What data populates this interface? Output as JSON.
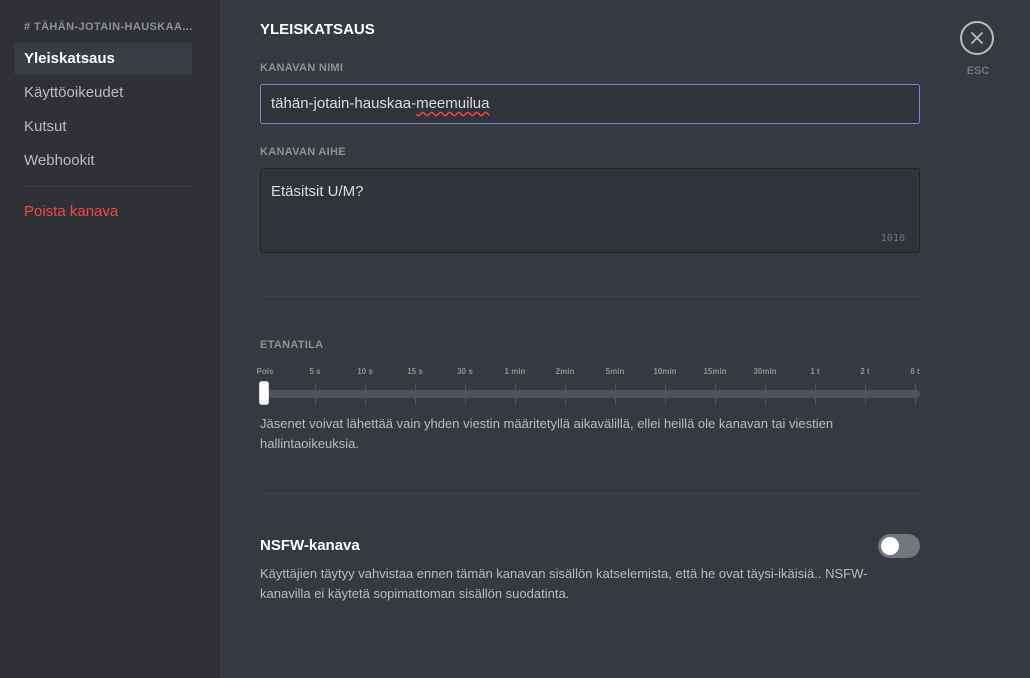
{
  "sidebar": {
    "channel_header": "# TÄHÄN-JOTAIN-HAUSKAA...",
    "items": [
      {
        "label": "Yleiskatsaus",
        "active": true
      },
      {
        "label": "Käyttöoikeudet"
      },
      {
        "label": "Kutsut"
      },
      {
        "label": "Webhookit"
      }
    ],
    "delete_label": "Poista kanava"
  },
  "main": {
    "title": "YLEISKATSAUS",
    "channel_name": {
      "label": "KANAVAN NIMI",
      "value_prefix": "tähän-jotain-hauskaa-",
      "value_misspelled": "meemuilua"
    },
    "channel_topic": {
      "label": "KANAVAN AIHE",
      "value": "Etäsitsit U/M?",
      "char_count": "1010"
    },
    "slowmode": {
      "label": "ETANATILA",
      "ticks": [
        "Pois",
        "5 s",
        "10 s",
        "15 s",
        "30 s",
        "1 min",
        "2min",
        "5min",
        "10min",
        "15min",
        "30min",
        "1 t",
        "2 t",
        "6 t"
      ],
      "selected": "Pois",
      "help": "Jäsenet voivat lähettää vain yhden viestin määritetyllä aikavälillä, ellei heillä ole kanavan tai viestien hallintaoikeuksia."
    },
    "nsfw": {
      "title": "NSFW-kanava",
      "enabled": false,
      "help": "Käyttäjien täytyy vahvistaa ennen tämän kanavan sisällön katselemista, että he ovat täysi-ikäisiä.. NSFW-kanavilla ei käytetä sopimattoman sisällön suodatinta."
    }
  },
  "close": {
    "esc_label": "ESC",
    "icon": "close-icon"
  },
  "colors": {
    "accent": "#7289da",
    "danger": "#f04747",
    "background": "#36393f",
    "sidebar": "#2f3136"
  }
}
